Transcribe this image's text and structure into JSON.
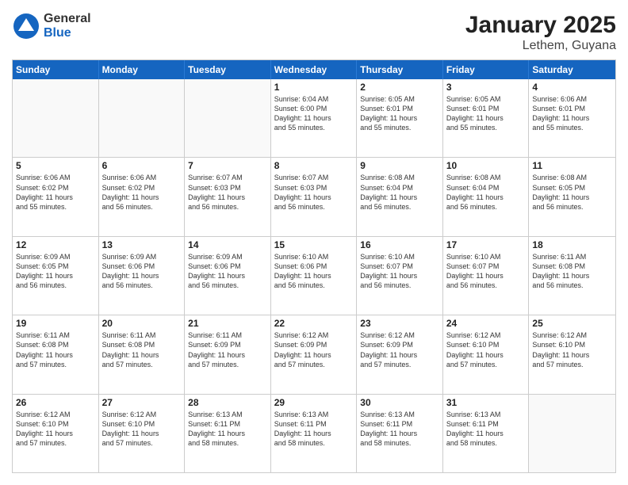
{
  "logo": {
    "general": "General",
    "blue": "Blue"
  },
  "title": "January 2025",
  "subtitle": "Lethem, Guyana",
  "headers": [
    "Sunday",
    "Monday",
    "Tuesday",
    "Wednesday",
    "Thursday",
    "Friday",
    "Saturday"
  ],
  "weeks": [
    [
      {
        "date": "",
        "info": ""
      },
      {
        "date": "",
        "info": ""
      },
      {
        "date": "",
        "info": ""
      },
      {
        "date": "1",
        "info": "Sunrise: 6:04 AM\nSunset: 6:00 PM\nDaylight: 11 hours\nand 55 minutes."
      },
      {
        "date": "2",
        "info": "Sunrise: 6:05 AM\nSunset: 6:01 PM\nDaylight: 11 hours\nand 55 minutes."
      },
      {
        "date": "3",
        "info": "Sunrise: 6:05 AM\nSunset: 6:01 PM\nDaylight: 11 hours\nand 55 minutes."
      },
      {
        "date": "4",
        "info": "Sunrise: 6:06 AM\nSunset: 6:01 PM\nDaylight: 11 hours\nand 55 minutes."
      }
    ],
    [
      {
        "date": "5",
        "info": "Sunrise: 6:06 AM\nSunset: 6:02 PM\nDaylight: 11 hours\nand 55 minutes."
      },
      {
        "date": "6",
        "info": "Sunrise: 6:06 AM\nSunset: 6:02 PM\nDaylight: 11 hours\nand 56 minutes."
      },
      {
        "date": "7",
        "info": "Sunrise: 6:07 AM\nSunset: 6:03 PM\nDaylight: 11 hours\nand 56 minutes."
      },
      {
        "date": "8",
        "info": "Sunrise: 6:07 AM\nSunset: 6:03 PM\nDaylight: 11 hours\nand 56 minutes."
      },
      {
        "date": "9",
        "info": "Sunrise: 6:08 AM\nSunset: 6:04 PM\nDaylight: 11 hours\nand 56 minutes."
      },
      {
        "date": "10",
        "info": "Sunrise: 6:08 AM\nSunset: 6:04 PM\nDaylight: 11 hours\nand 56 minutes."
      },
      {
        "date": "11",
        "info": "Sunrise: 6:08 AM\nSunset: 6:05 PM\nDaylight: 11 hours\nand 56 minutes."
      }
    ],
    [
      {
        "date": "12",
        "info": "Sunrise: 6:09 AM\nSunset: 6:05 PM\nDaylight: 11 hours\nand 56 minutes."
      },
      {
        "date": "13",
        "info": "Sunrise: 6:09 AM\nSunset: 6:06 PM\nDaylight: 11 hours\nand 56 minutes."
      },
      {
        "date": "14",
        "info": "Sunrise: 6:09 AM\nSunset: 6:06 PM\nDaylight: 11 hours\nand 56 minutes."
      },
      {
        "date": "15",
        "info": "Sunrise: 6:10 AM\nSunset: 6:06 PM\nDaylight: 11 hours\nand 56 minutes."
      },
      {
        "date": "16",
        "info": "Sunrise: 6:10 AM\nSunset: 6:07 PM\nDaylight: 11 hours\nand 56 minutes."
      },
      {
        "date": "17",
        "info": "Sunrise: 6:10 AM\nSunset: 6:07 PM\nDaylight: 11 hours\nand 56 minutes."
      },
      {
        "date": "18",
        "info": "Sunrise: 6:11 AM\nSunset: 6:08 PM\nDaylight: 11 hours\nand 56 minutes."
      }
    ],
    [
      {
        "date": "19",
        "info": "Sunrise: 6:11 AM\nSunset: 6:08 PM\nDaylight: 11 hours\nand 57 minutes."
      },
      {
        "date": "20",
        "info": "Sunrise: 6:11 AM\nSunset: 6:08 PM\nDaylight: 11 hours\nand 57 minutes."
      },
      {
        "date": "21",
        "info": "Sunrise: 6:11 AM\nSunset: 6:09 PM\nDaylight: 11 hours\nand 57 minutes."
      },
      {
        "date": "22",
        "info": "Sunrise: 6:12 AM\nSunset: 6:09 PM\nDaylight: 11 hours\nand 57 minutes."
      },
      {
        "date": "23",
        "info": "Sunrise: 6:12 AM\nSunset: 6:09 PM\nDaylight: 11 hours\nand 57 minutes."
      },
      {
        "date": "24",
        "info": "Sunrise: 6:12 AM\nSunset: 6:10 PM\nDaylight: 11 hours\nand 57 minutes."
      },
      {
        "date": "25",
        "info": "Sunrise: 6:12 AM\nSunset: 6:10 PM\nDaylight: 11 hours\nand 57 minutes."
      }
    ],
    [
      {
        "date": "26",
        "info": "Sunrise: 6:12 AM\nSunset: 6:10 PM\nDaylight: 11 hours\nand 57 minutes."
      },
      {
        "date": "27",
        "info": "Sunrise: 6:12 AM\nSunset: 6:10 PM\nDaylight: 11 hours\nand 57 minutes."
      },
      {
        "date": "28",
        "info": "Sunrise: 6:13 AM\nSunset: 6:11 PM\nDaylight: 11 hours\nand 58 minutes."
      },
      {
        "date": "29",
        "info": "Sunrise: 6:13 AM\nSunset: 6:11 PM\nDaylight: 11 hours\nand 58 minutes."
      },
      {
        "date": "30",
        "info": "Sunrise: 6:13 AM\nSunset: 6:11 PM\nDaylight: 11 hours\nand 58 minutes."
      },
      {
        "date": "31",
        "info": "Sunrise: 6:13 AM\nSunset: 6:11 PM\nDaylight: 11 hours\nand 58 minutes."
      },
      {
        "date": "",
        "info": ""
      }
    ]
  ]
}
